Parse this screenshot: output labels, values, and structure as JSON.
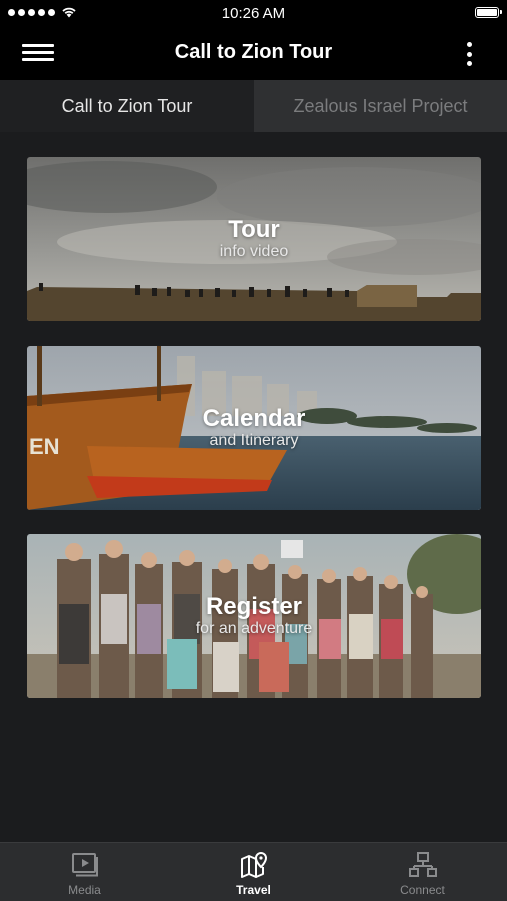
{
  "status_bar": {
    "time": "10:26 AM"
  },
  "nav": {
    "title": "Call to Zion Tour"
  },
  "tabs": [
    {
      "label": "Call to Zion Tour"
    },
    {
      "label": "Zealous Israel Project"
    }
  ],
  "cards": [
    {
      "title": "Tour",
      "subtitle": "info video"
    },
    {
      "title": "Calendar",
      "subtitle": "and Itinerary"
    },
    {
      "title": "Register",
      "subtitle": "for an adventure"
    }
  ],
  "tab_bar": [
    {
      "label": "Media",
      "icon": "media-icon"
    },
    {
      "label": "Travel",
      "icon": "map-pin-icon"
    },
    {
      "label": "Connect",
      "icon": "network-icon"
    }
  ],
  "colors": {
    "background": "#1b1c1e",
    "bar": "#000000",
    "active_tab": "#1f2022",
    "inactive_tab": "#2f3032",
    "tab_bar": "#2c2d2f"
  }
}
